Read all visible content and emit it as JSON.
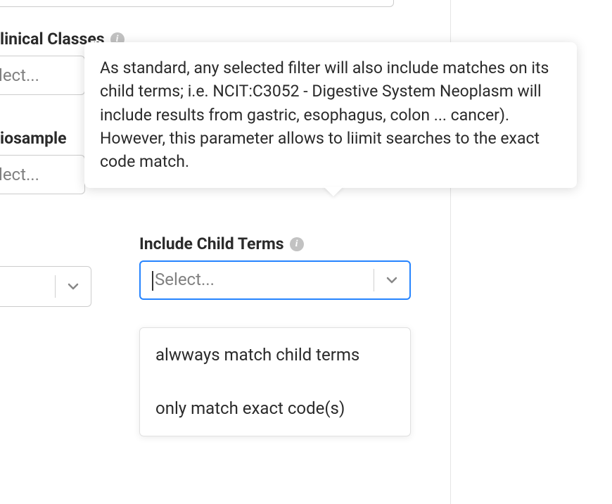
{
  "fields": {
    "clinical_classes": {
      "label": "linical Classes",
      "placeholder": "Select..."
    },
    "biosample": {
      "label": "iosample",
      "placeholder": "Select..."
    },
    "include_child_terms": {
      "label": "Include Child Terms",
      "placeholder": "Select...",
      "options": [
        "alwways match child terms",
        "only match exact code(s)"
      ]
    }
  },
  "tooltip": {
    "text": "As standard, any selected filter will also include matches on its child terms; i.e. NCIT:C3052 - Digestive System Neoplasm will include results from gastric, esophagus, colon ... cancer). However, this parameter allows to liimit searches to the exact code match."
  }
}
